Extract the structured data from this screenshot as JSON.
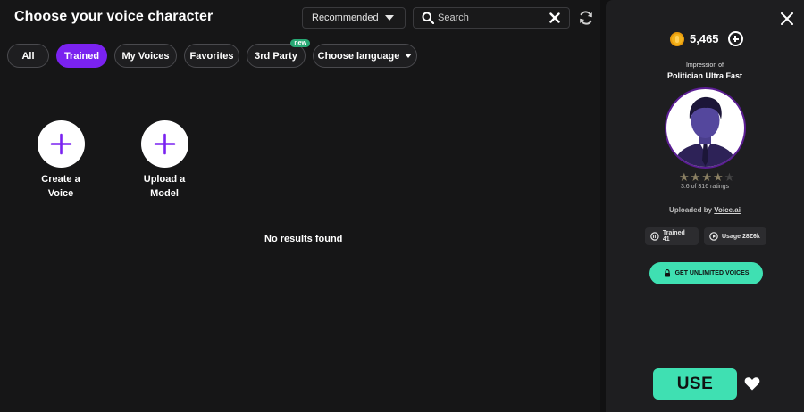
{
  "header": {
    "title": "Choose your voice character",
    "sort": {
      "selected": "Recommended"
    },
    "search": {
      "placeholder": "Search",
      "value": ""
    }
  },
  "filters": [
    {
      "label": "All",
      "active": false
    },
    {
      "label": "Trained",
      "active": true
    },
    {
      "label": "My Voices",
      "active": false
    },
    {
      "label": "Favorites",
      "active": false
    },
    {
      "label": "3rd Party",
      "active": false,
      "badge": "new"
    },
    {
      "label": "Choose language",
      "active": false
    }
  ],
  "tiles": [
    {
      "line1": "Create a",
      "line2": "Voice",
      "icon": "plus-icon"
    },
    {
      "line1": "Upload a",
      "line2": "Model",
      "icon": "plus-icon"
    }
  ],
  "results": {
    "empty_text": "No results found"
  },
  "details": {
    "credits": "5,465",
    "impression_of_label": "Impression of",
    "voice_name": "Politician Ultra Fast",
    "rating_value": 3.6,
    "rating_text": "3.6 of 316 ratings",
    "uploaded_by_label": "Uploaded by",
    "uploaded_by_name": "Voice.ai",
    "trained": "Trained 41",
    "usage": "Usage 28Z6k",
    "unlimited_label": "GET UNLIMITED VOICES",
    "use_label": "USE"
  },
  "colors": {
    "accent_purple": "#7a22f0",
    "accent_teal": "#3fe0b2",
    "badge_green": "#27a874",
    "coin_gold": "#f3b21b"
  }
}
